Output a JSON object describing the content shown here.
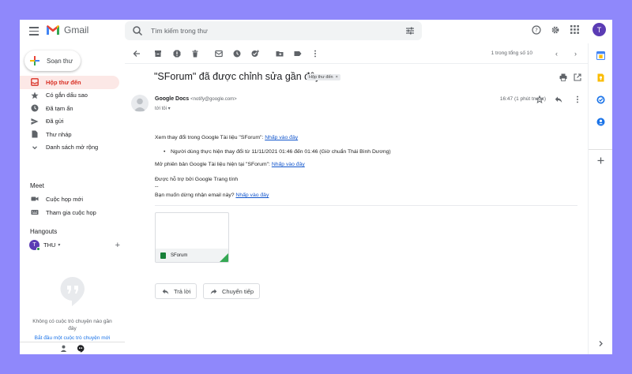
{
  "app": {
    "name": "Gmail"
  },
  "search": {
    "placeholder": "Tìm kiếm trong thư"
  },
  "account": {
    "avatar_initial": "T"
  },
  "sidebar": {
    "compose_label": "Soạn thư",
    "items": [
      {
        "label": "Hộp thư đến",
        "icon": "inbox-icon",
        "active": true
      },
      {
        "label": "Có gắn dấu sao",
        "icon": "star-icon"
      },
      {
        "label": "Đã tạm ẩn",
        "icon": "clock-icon"
      },
      {
        "label": "Đã gửi",
        "icon": "send-icon"
      },
      {
        "label": "Thư nháp",
        "icon": "draft-icon"
      },
      {
        "label": "Danh sách mở rộng",
        "icon": "chevron-down-icon"
      }
    ],
    "meet": {
      "title": "Meet",
      "items": [
        {
          "label": "Cuộc họp mới",
          "icon": "video-icon"
        },
        {
          "label": "Tham gia cuộc họp",
          "icon": "keyboard-icon"
        }
      ]
    },
    "hangouts": {
      "title": "Hangouts",
      "user_initial": "T",
      "user_name": "THU",
      "no_chats_text": "Không có cuộc trò chuyện nào gần đây",
      "start_chat_link": "Bắt đầu một cuộc trò chuyện mới"
    }
  },
  "toolbar": {
    "pager_text": "1 trong tổng số 10"
  },
  "email": {
    "subject": "\"SForum\" đã được chỉnh sửa gần đây",
    "label_chip": "Hộp thư đến",
    "label_chip_close": "×",
    "sender_name": "Google Docs",
    "sender_email": "<notify@google.com>",
    "to_text": "tới tôi",
    "time": "16:47 (1 phút trước)",
    "line1_text": "Xem thay đổi trong Google Tài liệu \"SForum\": ",
    "line1_link": "Nhấp vào đây",
    "bullet_text": "Người dùng thực hiện thay đổi từ 11/11/2021 01:46 đến 01:46 (Giờ chuẩn Thái Bình Dương)",
    "line2_text": "Mở phiên bản Google Tài liệu hiện tại \"SForum\": ",
    "line2_link": "Nhấp vào đây",
    "line3_text": "Được hỗ trợ bởi Google Trang tính",
    "separator": "--",
    "line4_text": "Bạn muốn dừng nhận email này? ",
    "line4_link": "Nhấp vào đây",
    "attachment_name": "SForum",
    "reply_label": "Trả lời",
    "forward_label": "Chuyển tiếp"
  },
  "colors": {
    "background": "#8f88fb",
    "active_nav": "#fce8e6",
    "active_text": "#d93025",
    "link": "#1155cc",
    "avatar": "#5b3cb4"
  }
}
